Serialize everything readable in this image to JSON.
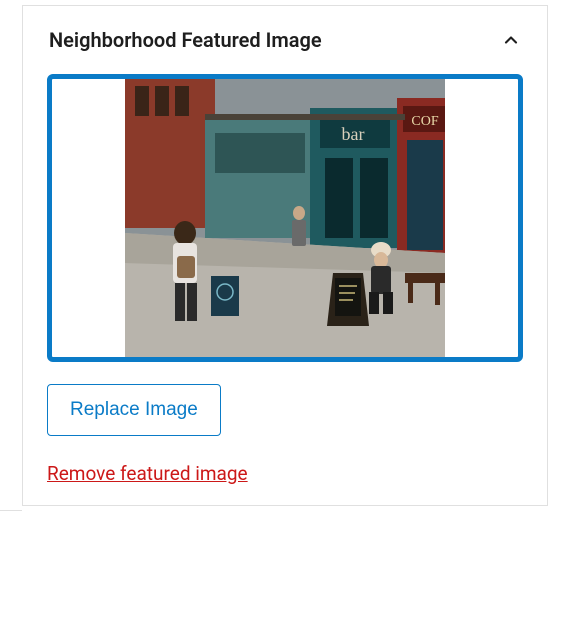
{
  "panel": {
    "title": "Neighborhood Featured Image",
    "replace_label": "Replace Image",
    "remove_label": "Remove featured image"
  }
}
